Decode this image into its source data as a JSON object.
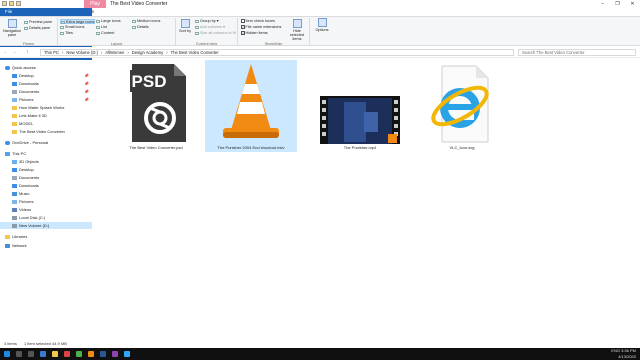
{
  "titlebar": {
    "context_tab": "Play",
    "title": "The Best Video Converter",
    "controls": [
      "–",
      "❐",
      "✕"
    ]
  },
  "ribbon_tabs": [
    "File",
    "Home",
    "Share",
    "View",
    "Video Tools"
  ],
  "ribbon": {
    "panes": {
      "label": "Panes",
      "navigation_pane": "Navigation pane",
      "preview_pane": "Preview pane",
      "details_pane": "Details pane"
    },
    "layout": {
      "label": "Layout",
      "options": [
        "Extra large icons",
        "Large icons",
        "Medium icons",
        "Small icons",
        "List",
        "Details",
        "Tiles",
        "Content"
      ],
      "selected": "Extra large icons"
    },
    "current_view": {
      "label": "Current view",
      "sort_by": "Sort by",
      "group_by": "Group by ▾",
      "add_columns": "Add columns ▾",
      "size_all_columns": "Size all columns to fit"
    },
    "show_hide": {
      "label": "Show/hide",
      "item_check_boxes": "Item check boxes",
      "file_name_extensions": "File name extensions",
      "hidden_items": "Hidden items",
      "hide_selected_items": "Hide selected items",
      "checks": {
        "item_check_boxes": false,
        "file_name_extensions": true,
        "hidden_items": true
      }
    },
    "options": "Options"
  },
  "address": {
    "back": "←",
    "forward": "→",
    "up": "↑",
    "path": [
      "This PC",
      "New Volume (D:)",
      "AllWomen",
      "Design Academy",
      "The Best Video Converter"
    ],
    "search_placeholder": "Search The Best Video Converter"
  },
  "nav": {
    "quick_access": "Quick access",
    "pinned": [
      "Desktop",
      "Downloads",
      "Documents",
      "Pictures"
    ],
    "recent": [
      "How Water Splash Works",
      "Lets Make it 3D",
      "MODEL",
      "The Best Video Converter"
    ],
    "onedrive": "OneDrive - Personal",
    "this_pc": "This PC",
    "pc_items": [
      "3D Objects",
      "Desktop",
      "Documents",
      "Downloads",
      "Music",
      "Pictures",
      "Videos",
      "Local Disk (C:)",
      "New Volume (D:)"
    ],
    "libraries": "Libraries",
    "network": "Network",
    "pin_glyph": "📌"
  },
  "files": [
    {
      "name": "The Best Video Converter.psd",
      "icon": "psd-file-icon",
      "badge": "PSD"
    },
    {
      "name": "The Punisher 2004 End shootout.mkv",
      "icon": "vlc-cone-icon"
    },
    {
      "name": "The Punisher.mp4",
      "icon": "video-thumbnail-icon"
    },
    {
      "name": "VLC_Icon.svg",
      "icon": "internet-explorer-icon"
    }
  ],
  "status": {
    "items": "4 items",
    "selected": "1 item selected",
    "size": "44.9 MB"
  },
  "tray": {
    "lang": "ENG",
    "time": "3:36 PM",
    "date": "4/13/2020"
  }
}
